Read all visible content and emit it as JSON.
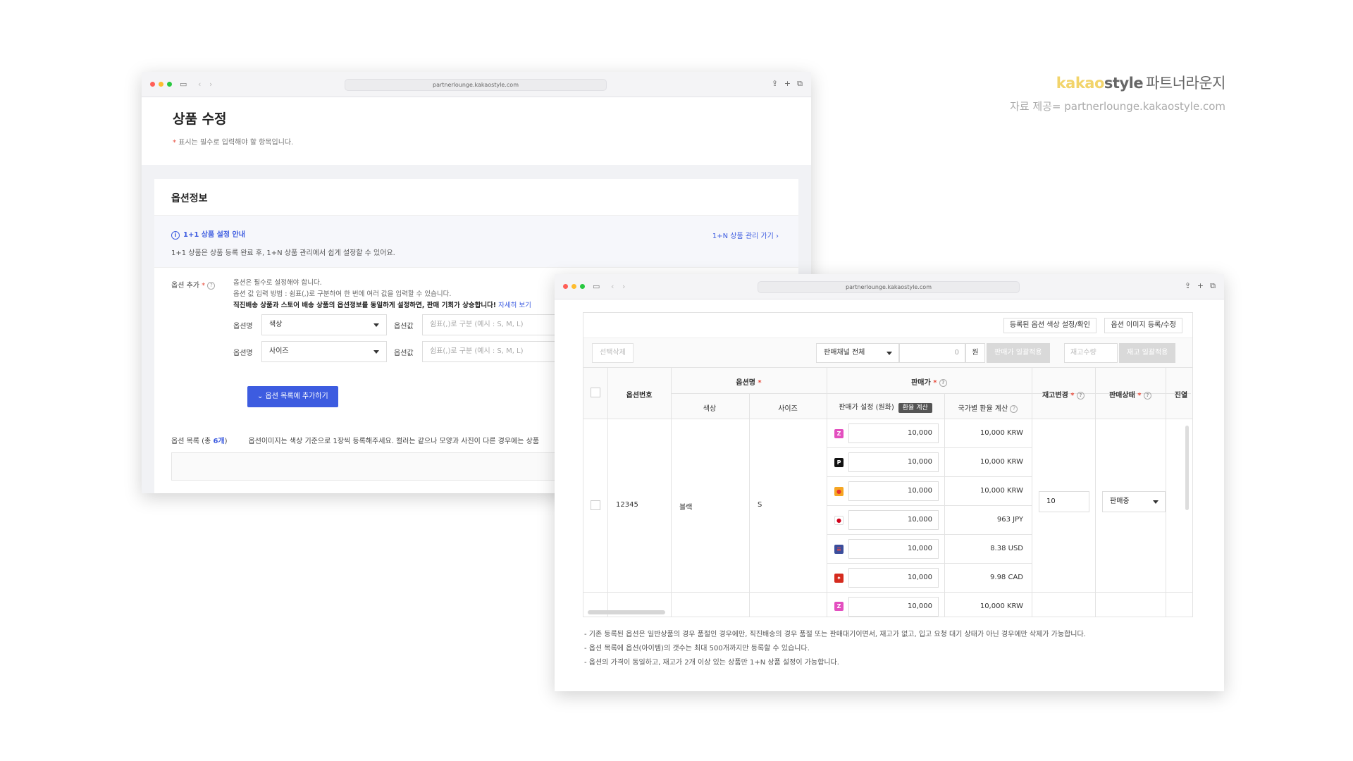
{
  "brand": {
    "kakao": "kakao",
    "style": "style",
    "name": "파트너라운지",
    "source": "자료 제공= partnerlounge.kakaostyle.com"
  },
  "window1": {
    "url": "partnerlounge.kakaostyle.com",
    "page_title": "상품 수정",
    "required_note_mark": "*",
    "required_note": "표시는 필수로 입력해야 할 항목입니다.",
    "section_title": "옵션정보",
    "notice": {
      "title": "1+1 상품 설정 안내",
      "desc": "1+1 상품은 상품 등록 완료 후, 1+N 상품 관리에서 쉽게 설정할 수 있어요.",
      "link": "1+N 상품 관리 가기 ›"
    },
    "option_add": {
      "label": "옵션 추가",
      "help1": "옵션은 필수로 설정해야 합니다.",
      "help2": "옵션 값 입력 방법 : 쉼표(,)로 구분하여 한 번에 여러 값을 입력할 수 있습니다.",
      "help3": "직진배송 상품과 스토어 배송 상품의 옵션정보를 동일하게 설정하면, 판매 기회가 상승합니다!",
      "help3_link": "자세히 보기",
      "rows": [
        {
          "name_label": "옵션명",
          "name_value": "색상",
          "value_label": "옵션값",
          "value_placeholder": "쉼표(,)로 구분 (예시 : S, M, L)"
        },
        {
          "name_label": "옵션명",
          "name_value": "사이즈",
          "value_label": "옵션값",
          "value_placeholder": "쉼표(,)로 구분 (예시 : S, M, L)"
        }
      ],
      "add_button": "⌄ 옵션 목록에 추가하기"
    },
    "option_list": {
      "label": "옵션 목록 (총 ",
      "count": "6개",
      "label_end": ")",
      "guide": "옵션이미지는 색상 기준으로 1장씩 등록해주세요. 컬러는 같으나 모양과 사진이 다른 경우에는 상품"
    }
  },
  "window2": {
    "url": "partnerlounge.kakaostyle.com",
    "btn_color": "등록된 옵션 색상 설정/확인",
    "btn_image": "옵션 이미지 등록/수정",
    "btn_delete": "선택삭제",
    "channel_select": "판매채널 전체",
    "price_input": "0",
    "won": "원",
    "btn_apply_price": "판매가 일괄적용",
    "stock_placeholder": "재고수량",
    "btn_apply_stock": "재고 일괄적용",
    "headers": {
      "option_no": "옵션번호",
      "option_name": "옵션명",
      "color": "색상",
      "size": "사이즈",
      "price": "판매가",
      "price_setting": "판매가 설정 (원화)",
      "calc": "환율 계산",
      "country_conv": "국가별 환율 계산",
      "stock": "재고변경",
      "status": "판매상태",
      "extra": "진열"
    },
    "row": {
      "option_no": "12345",
      "color": "블랙",
      "size": "S",
      "stock": "10",
      "status": "판매중"
    },
    "prices": [
      {
        "icon": "zigzag-icon",
        "flag_color": "#e34fbf",
        "glyph": "Z",
        "price": "10,000",
        "converted": "10,000 KRW"
      },
      {
        "icon": "posty-icon",
        "flag_color": "#111111",
        "glyph": "P",
        "price": "10,000",
        "converted": "10,000 KRW"
      },
      {
        "icon": "fashionbyki-icon",
        "flag_color": "#f5a623",
        "glyph": "●",
        "price": "10,000",
        "converted": "10,000 KRW"
      },
      {
        "icon": "japan-flag-icon",
        "flag_color": "#ffffff",
        "glyph": "●",
        "price": "10,000",
        "converted": "963 JPY"
      },
      {
        "icon": "usa-flag-icon",
        "flag_color": "#3b4e9c",
        "glyph": "≡",
        "price": "10,000",
        "converted": "8.38 USD"
      },
      {
        "icon": "canada-flag-icon",
        "flag_color": "#d52b1e",
        "glyph": "✦",
        "price": "10,000",
        "converted": "9.98 CAD"
      }
    ],
    "next_row_price": "10,000",
    "next_row_converted": "10,000 KRW",
    "notes": [
      "- 기존 등록된 옵션은 일반상품의 경우 품절인 경우에만, 직진배송의 경우 품절 또는 판매대기이면서, 재고가 없고, 입고 요청 대기 상태가 아닌 경우에만 삭제가 가능합니다.",
      "- 옵션 목록에 옵션(아이템)의 갯수는 최대 500개까지만 등록할 수 있습니다.",
      "- 옵션의 가격이 동일하고, 재고가 2개 이상 있는 상품만 1+N 상품 설정이 가능합니다."
    ]
  },
  "colors": {
    "accent": "#3d5ce0",
    "required": "#e74c3c",
    "dot_red": "#ff5f57",
    "dot_yellow": "#febc2e",
    "dot_green": "#28c840"
  }
}
